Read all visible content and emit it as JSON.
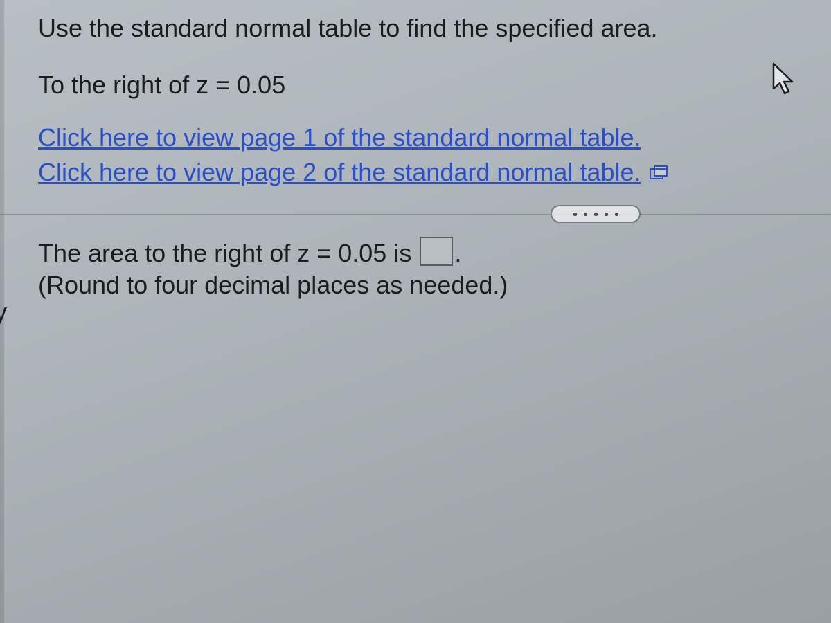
{
  "question": {
    "prompt": "Use the standard normal table to find the specified area.",
    "condition": "To the right of z = 0.05"
  },
  "links": {
    "page1": "Click here to view page 1 of the standard normal table.",
    "page2": "Click here to view page 2 of the standard normal table."
  },
  "answer": {
    "prefix": "The area to the right of z = 0.05 is ",
    "suffix": ".",
    "hint": "(Round to four decimal places as needed.)"
  },
  "edge_letter": "y"
}
